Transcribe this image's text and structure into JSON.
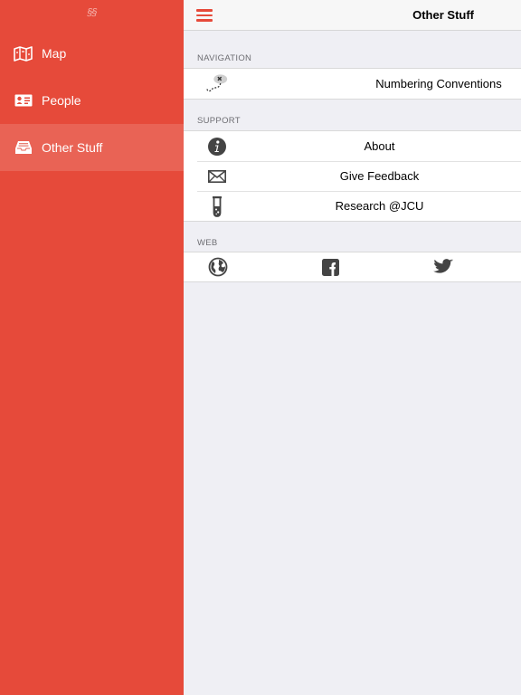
{
  "sidebar": {
    "logo": "§§",
    "items": [
      {
        "label": "Map",
        "icon": "map-icon"
      },
      {
        "label": "People",
        "icon": "id-card-icon"
      },
      {
        "label": "Other Stuff",
        "icon": "inbox-tray-icon",
        "active": true
      }
    ]
  },
  "header": {
    "title": "Other Stuff",
    "menu_icon": "hamburger-icon"
  },
  "sections": {
    "navigation": {
      "title": "NAVIGATION",
      "rows": [
        {
          "label": "Numbering Conventions",
          "icon": "treasure-map-icon"
        }
      ]
    },
    "support": {
      "title": "SUPPORT",
      "rows": [
        {
          "label": "About",
          "icon": "info-icon"
        },
        {
          "label": "Give Feedback",
          "icon": "envelope-icon"
        },
        {
          "label": "Research @JCU",
          "icon": "test-tube-icon"
        }
      ]
    },
    "web": {
      "title": "WEB",
      "icons": [
        "globe-icon",
        "facebook-icon",
        "twitter-icon"
      ]
    }
  },
  "colors": {
    "accent": "#e64a3a",
    "background": "#efeff4",
    "icon": "#444444"
  }
}
